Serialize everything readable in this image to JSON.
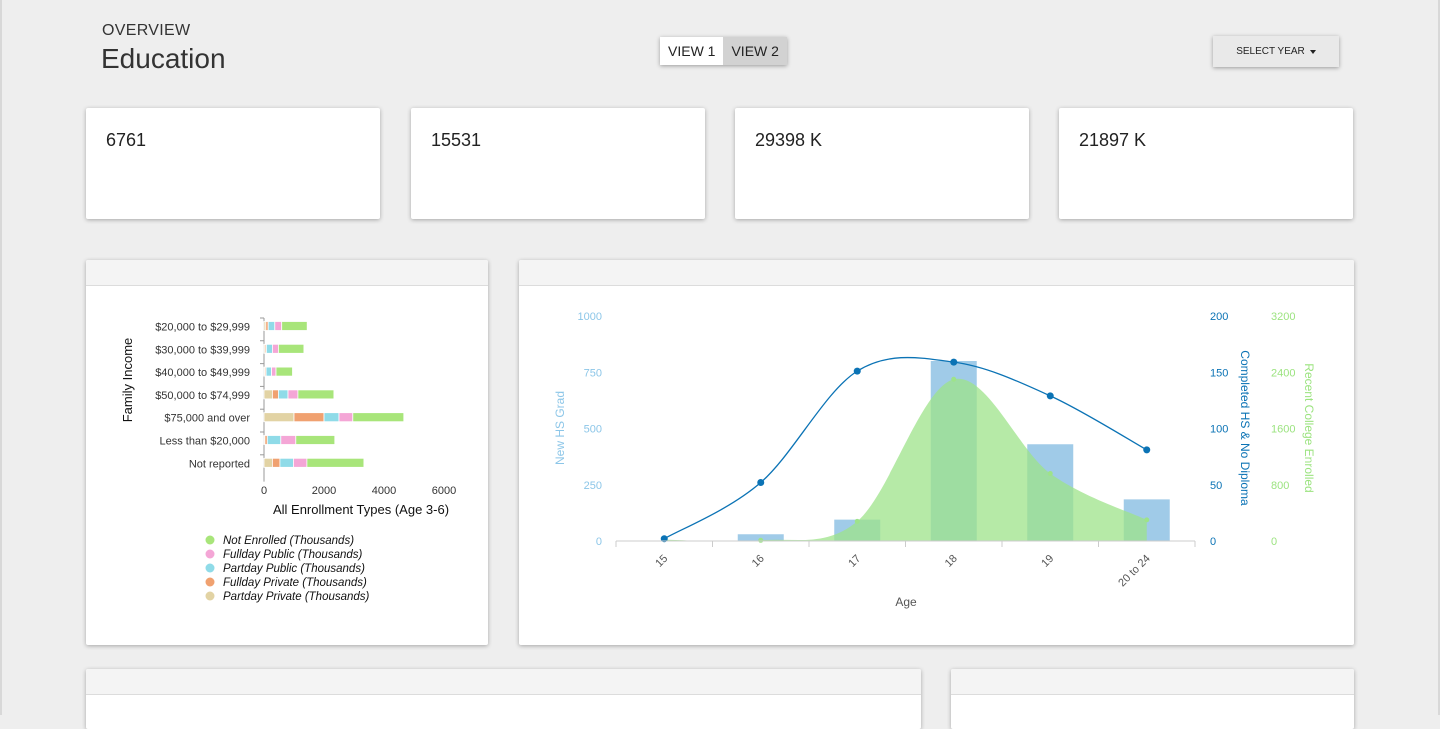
{
  "header": {
    "eyebrow": "OVERVIEW",
    "title": "Education"
  },
  "view_toggle": {
    "view1": "VIEW 1",
    "view2": "VIEW 2",
    "active": "view2"
  },
  "year_select": {
    "label": "SELECT YEAR"
  },
  "stats": [
    {
      "value": "6761"
    },
    {
      "value": "15531"
    },
    {
      "value": "29398 K"
    },
    {
      "value": "21897 K"
    }
  ],
  "chart_data": [
    {
      "type": "bar",
      "orientation": "horizontal",
      "stacked": true,
      "title": "",
      "xlabel": "All Enrollment Types (Age 3-6)",
      "ylabel": "Family Income",
      "xlim": [
        0,
        6000
      ],
      "xticks": [
        "0",
        "2000",
        "4000",
        "6000"
      ],
      "categories": [
        "$20,000 to $29,999",
        "$30,000 to $39,999",
        "$40,000 to $49,999",
        "$50,000 to $74,999",
        "$75,000 and over",
        "Less than $20,000",
        "Not reported"
      ],
      "series": [
        {
          "name": "Partday Private (Thousands)",
          "color": "#e2d3a4",
          "values": [
            60,
            40,
            30,
            280,
            1000,
            30,
            280
          ]
        },
        {
          "name": "Fullday Private (Thousands)",
          "color": "#f0a170",
          "values": [
            80,
            40,
            40,
            200,
            1000,
            80,
            250
          ]
        },
        {
          "name": "Partday Public (Thousands)",
          "color": "#8fdbe8",
          "values": [
            220,
            200,
            180,
            320,
            500,
            450,
            450
          ]
        },
        {
          "name": "Fullday Public (Thousands)",
          "color": "#f4a6d6",
          "values": [
            230,
            200,
            150,
            330,
            460,
            500,
            450
          ]
        },
        {
          "name": "Not Enrolled (Thousands)",
          "color": "#a8e57a",
          "values": [
            850,
            850,
            550,
            1200,
            1700,
            1300,
            1900
          ]
        }
      ],
      "legend_order": [
        "Not Enrolled (Thousands)",
        "Fullday Public (Thousands)",
        "Partday Public (Thousands)",
        "Fullday Private (Thousands)",
        "Partday Private (Thousands)"
      ],
      "legend_position": "bottom"
    },
    {
      "type": "combo",
      "title": "",
      "xlabel": "Age",
      "categories": [
        "15",
        "16",
        "17",
        "18",
        "19",
        "20 to 24"
      ],
      "axes": {
        "left": {
          "label": "New HS Grad",
          "range": [
            0,
            1000
          ],
          "ticks": [
            "0",
            "250",
            "500",
            "750",
            "1000"
          ],
          "color": "#8cc6e8"
        },
        "right1": {
          "label": "Completed HS & No Diploma",
          "range": [
            0,
            200
          ],
          "ticks": [
            "0",
            "50",
            "100",
            "150",
            "200"
          ],
          "color": "#0b73b5"
        },
        "right2": {
          "label": "Recent College Enrolled",
          "range": [
            0,
            3200
          ],
          "ticks": [
            "0",
            "800",
            "1600",
            "2400",
            "3200"
          ],
          "color": "#9be37f"
        }
      },
      "series": [
        {
          "name": "New HS Grad",
          "type": "bar",
          "axis": "left",
          "color": "#a0cbe8",
          "values": [
            0,
            30,
            95,
            800,
            430,
            185
          ]
        },
        {
          "name": "Completed HS & No Diploma",
          "type": "line",
          "axis": "right1",
          "color": "#0b73b5",
          "values": [
            2,
            52,
            151,
            159,
            129,
            81
          ]
        },
        {
          "name": "Recent College Enrolled",
          "type": "area",
          "axis": "right2",
          "color": "#9ee38a",
          "values": [
            20,
            10,
            280,
            2300,
            960,
            300
          ]
        }
      ]
    }
  ]
}
